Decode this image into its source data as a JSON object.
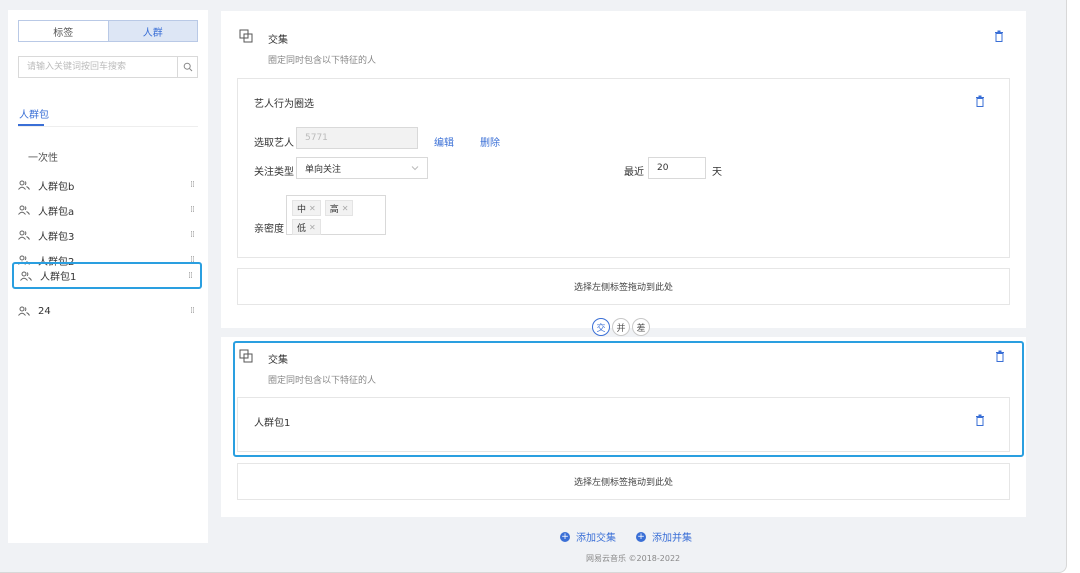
{
  "sidebar": {
    "tabs": [
      "标签",
      "人群"
    ],
    "search_placeholder": "请输入关键词按回车搜索",
    "section_tab": "人群包",
    "group_title": "一次性",
    "items": [
      "人群包b",
      "人群包a",
      "人群包3",
      "人群包2",
      "人群包1",
      "24"
    ],
    "selected_item": "人群包1"
  },
  "block1": {
    "title": "交集",
    "subtitle": "圈定同时包含以下特征的人",
    "filter": {
      "title": "艺人行为圈选",
      "artist_label": "选取艺人",
      "artist_value": "5771",
      "edit_label": "编辑",
      "delete_label": "删除",
      "follow_label": "关注类型",
      "follow_value": "单向关注",
      "recent_label": "最近",
      "recent_value": "20",
      "days_label": "天",
      "intimacy_label": "亲密度",
      "intimacy_tags": [
        "中",
        "高",
        "低"
      ]
    },
    "drop_hint": "选择左侧标签拖动到此处"
  },
  "set_ops": [
    "交",
    "并",
    "差"
  ],
  "block2": {
    "title": "交集",
    "subtitle": "圈定同时包含以下特征的人",
    "item": "人群包1",
    "drop_hint": "选择左侧标签拖动到此处"
  },
  "footer": {
    "add_intersection": "添加交集",
    "add_union": "添加并集",
    "copyright": "网易云音乐 ©2018-2022"
  },
  "colors": {
    "accent": "#3a6fd6",
    "selected_border": "#2a9fe0",
    "page_bg": "#f0f2f5"
  }
}
